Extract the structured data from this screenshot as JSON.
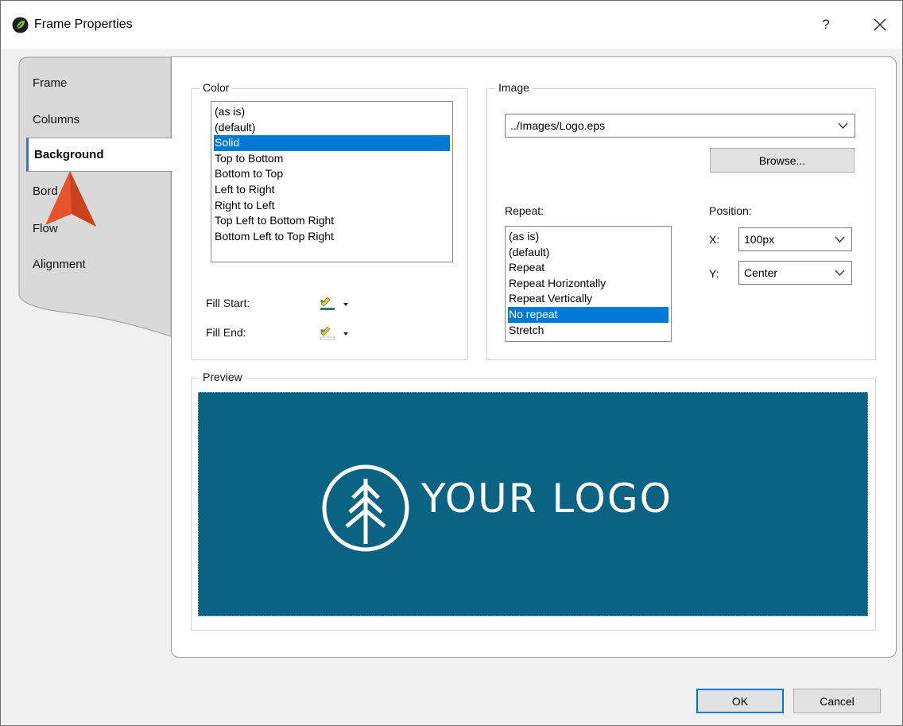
{
  "window": {
    "title": "Frame Properties",
    "help": "?",
    "close": "close"
  },
  "tabs": [
    "Frame",
    "Columns",
    "Background",
    "Borders",
    "Flow",
    "Alignment"
  ],
  "tab_visible": {
    "borders": "Bord"
  },
  "active_tab": "Background",
  "color_group": {
    "legend": "Color",
    "options": [
      "(as is)",
      "(default)",
      "Solid",
      "Top to Bottom",
      "Bottom to Top",
      "Left to Right",
      "Right to Left",
      "Top Left to Bottom Right",
      "Bottom Left to Top Right"
    ],
    "selected": "Solid",
    "fill_start_label": "Fill Start:",
    "fill_end_label": "Fill End:"
  },
  "image_group": {
    "legend": "Image",
    "path": "../Images/Logo.eps",
    "browse_label": "Browse...",
    "repeat_label": "Repeat:",
    "repeat_options": [
      "(as is)",
      "(default)",
      "Repeat",
      "Repeat Horizontally",
      "Repeat Vertically",
      "No repeat",
      "Stretch"
    ],
    "repeat_selected": "No repeat",
    "position_label": "Position:",
    "x_label": "X:",
    "x_value": "100px",
    "y_label": "Y:",
    "y_value": "Center"
  },
  "preview": {
    "legend": "Preview",
    "logo_text": "YOUR LOGO",
    "background_color": "#0b6384"
  },
  "footer": {
    "ok_label": "OK",
    "cancel_label": "Cancel"
  },
  "colors": {
    "accent": "#0078d7",
    "cursor": "#e8542a"
  }
}
